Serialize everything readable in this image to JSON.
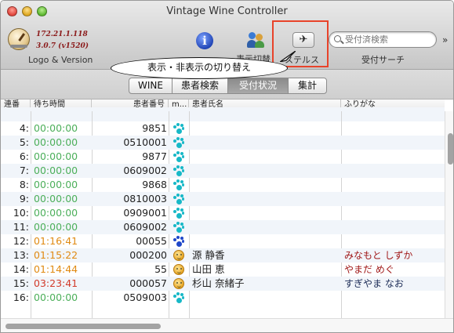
{
  "window": {
    "title": "Vintage Wine Controller"
  },
  "toolbar": {
    "logo_label": "Logo & Version",
    "ip": "172.21.1.118",
    "version": "3.0.7 (v1520)",
    "info_label": "",
    "group_label": "表示切替",
    "stealth_label": "ステルス",
    "search_placeholder": "受付済検索",
    "search_label": "受付サーチ",
    "stealth_glyph": "✈"
  },
  "callout": {
    "text": "表示・非表示の切り替え",
    "border_color": "#e8432a"
  },
  "tabs": [
    {
      "label": "WINE",
      "active": false
    },
    {
      "label": "患者検索",
      "active": false
    },
    {
      "label": "受付状況",
      "active": true
    },
    {
      "label": "集計",
      "active": false
    }
  ],
  "table": {
    "columns": [
      "連番",
      "待ち時間",
      "患者番号",
      "m...",
      "患者氏名",
      "ふりがな"
    ],
    "rows": [
      {
        "num": "4:",
        "wait": "00:00:00",
        "pid": "9851",
        "mark": "paw-cyan",
        "name": "",
        "kana": ""
      },
      {
        "num": "5:",
        "wait": "00:00:00",
        "pid": "0510001",
        "mark": "paw-cyan",
        "name": "",
        "kana": ""
      },
      {
        "num": "6:",
        "wait": "00:00:00",
        "pid": "9877",
        "mark": "paw-cyan",
        "name": "",
        "kana": ""
      },
      {
        "num": "7:",
        "wait": "00:00:00",
        "pid": "0609002",
        "mark": "paw-cyan",
        "name": "",
        "kana": ""
      },
      {
        "num": "8:",
        "wait": "00:00:00",
        "pid": "9868",
        "mark": "paw-cyan",
        "name": "",
        "kana": ""
      },
      {
        "num": "9:",
        "wait": "00:00:00",
        "pid": "0810003",
        "mark": "paw-cyan",
        "name": "",
        "kana": ""
      },
      {
        "num": "10:",
        "wait": "00:00:00",
        "pid": "0909001",
        "mark": "paw-cyan",
        "name": "",
        "kana": ""
      },
      {
        "num": "11:",
        "wait": "00:00:00",
        "pid": "0609002",
        "mark": "paw-cyan",
        "name": "",
        "kana": ""
      },
      {
        "num": "12:",
        "wait": "01:16:41",
        "pid": "00055",
        "mark": "paw-blue",
        "name": "",
        "kana": ""
      },
      {
        "num": "13:",
        "wait": "01:15:22",
        "pid": "000200",
        "mark": "face",
        "name": "源 静香",
        "kana": "みなもと しずか"
      },
      {
        "num": "14:",
        "wait": "01:14:44",
        "pid": "55",
        "mark": "face",
        "name": "山田 恵",
        "kana": "やまだ めぐ"
      },
      {
        "num": "15:",
        "wait": "03:23:41",
        "pid": "000057",
        "mark": "face",
        "name": "杉山 奈緒子",
        "kana": "すぎやま なお"
      },
      {
        "num": "16:",
        "wait": "00:00:00",
        "pid": "0509003",
        "mark": "paw-cyan",
        "name": "",
        "kana": ""
      }
    ]
  },
  "colors": {
    "wait_zero": "#4caf5a",
    "wait_orange": "#e08a12",
    "wait_red": "#d23a2a",
    "kana_red": "#a01818",
    "kana_blue": "#1a2a55",
    "paw_cyan": "#17b8c7",
    "paw_blue": "#1f47c9"
  }
}
